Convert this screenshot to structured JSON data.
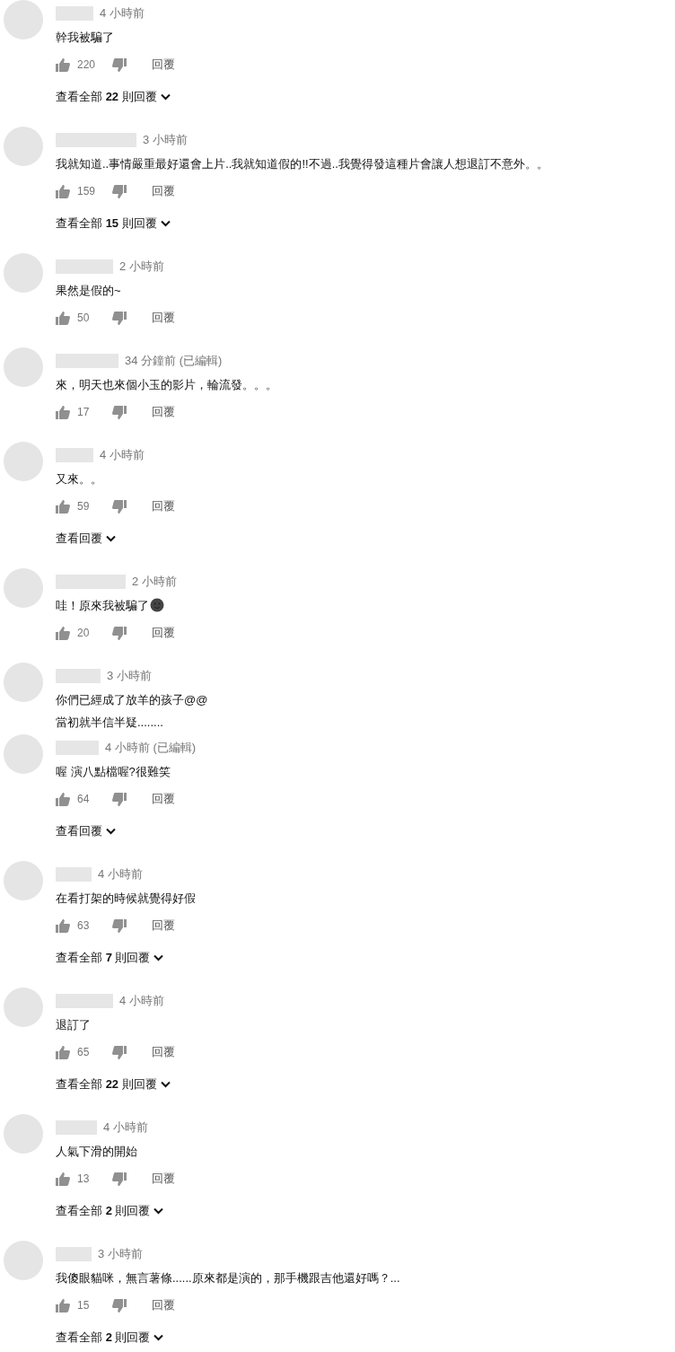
{
  "comments": [
    {
      "time": "4 小時前",
      "lines": [
        "幹我被騙了"
      ],
      "likes": "220",
      "reply": "回覆",
      "replies_link": "查看全部 **22** 則回覆"
    },
    {
      "time": "3 小時前",
      "lines": [
        "我就知道..事情嚴重最好還會上片..我就知道假的!!不過..我覺得發這種片會讓人想退訂不意外。。"
      ],
      "likes": "159",
      "reply": "回覆",
      "replies_link": "查看全部 **15** 則回覆"
    },
    {
      "time": "2 小時前",
      "lines": [
        "果然是假的~"
      ],
      "likes": "50",
      "reply": "回覆"
    },
    {
      "time": "34 分鐘前 (已編輯)",
      "lines": [
        "來，明天也來個小玉的影片，輪流發。。。"
      ],
      "likes": "17",
      "reply": "回覆"
    },
    {
      "time": "4 小時前",
      "lines": [
        "又來。。"
      ],
      "likes": "59",
      "reply": "回覆",
      "replies_link": "查看回覆"
    },
    {
      "time": "2 小時前",
      "lines": [
        "哇！原來我被騙了"
      ],
      "with_emoji": true,
      "likes": "20",
      "reply": "回覆"
    },
    {
      "time": "3 小時前",
      "lines": [
        "你們已經成了放羊的孩子@@",
        "當初就半信半疑........"
      ]
    },
    {
      "time": "4 小時前 (已編輯)",
      "lines": [
        "喔 演八點檔喔?很難笑"
      ],
      "likes": "64",
      "reply": "回覆",
      "replies_link": "查看回覆"
    },
    {
      "time": "4 小時前",
      "lines": [
        "在看打架的時候就覺得好假"
      ],
      "likes": "63",
      "reply": "回覆",
      "replies_link": "查看全部 **7** 則回覆"
    },
    {
      "time": "4 小時前",
      "lines": [
        "退訂了"
      ],
      "likes": "65",
      "reply": "回覆",
      "replies_link": "查看全部 **22** 則回覆"
    },
    {
      "time": "4 小時前",
      "lines": [
        "人氣下滑的開始"
      ],
      "likes": "13",
      "reply": "回覆",
      "replies_link": "查看全部 **2** 則回覆"
    },
    {
      "time": "3 小時前",
      "lines": [
        "我傻眼貓咪，無言薯條......原來都是演的，那手機跟吉他還好嗎？..."
      ],
      "likes": "15",
      "reply": "回覆",
      "replies_link": "查看全部 **2** 則回覆"
    }
  ]
}
